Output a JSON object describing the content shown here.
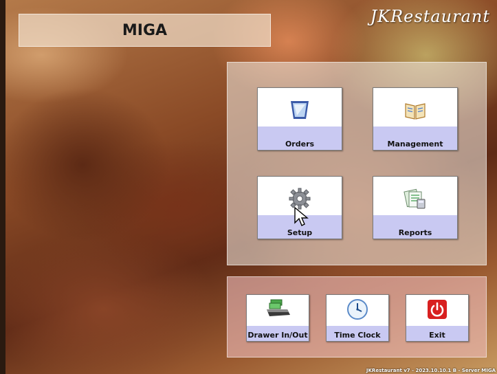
{
  "header": {
    "title": "MIGA",
    "brand": "JKRestaurant"
  },
  "main_menu": [
    {
      "label": "Orders",
      "icon": "orders-icon"
    },
    {
      "label": "Management",
      "icon": "book-icon"
    },
    {
      "label": "Setup",
      "icon": "gear-icon"
    },
    {
      "label": "Reports",
      "icon": "reports-icon"
    }
  ],
  "bottom_menu": [
    {
      "label": "Drawer In/Out",
      "icon": "cash-drawer-icon"
    },
    {
      "label": "Time Clock",
      "icon": "clock-icon"
    },
    {
      "label": "Exit",
      "icon": "power-icon"
    }
  ],
  "footer": {
    "version": "JKRestaurant v7 - 2023.10.10.1 B - Server MIGA"
  },
  "colors": {
    "tile_band": "#c9c9f2",
    "exit_red": "#d82020"
  }
}
